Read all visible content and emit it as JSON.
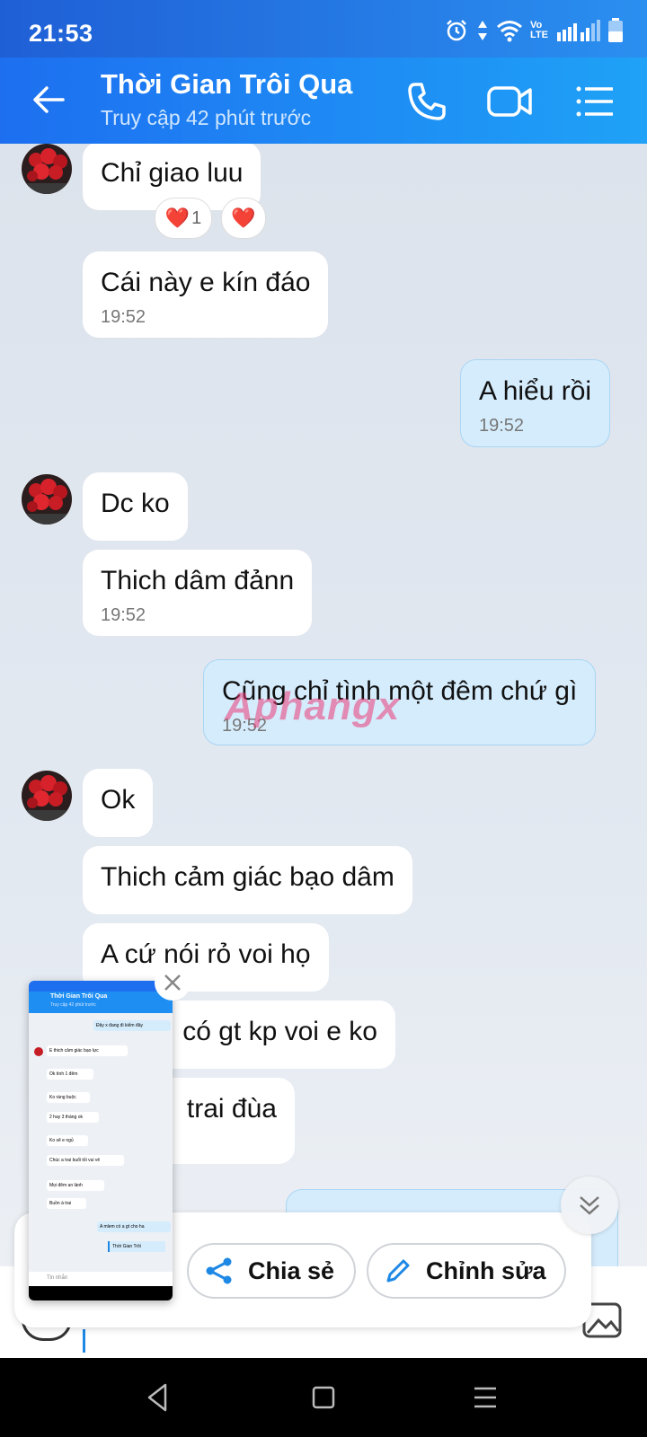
{
  "status_bar": {
    "time": "21:53",
    "network_label": "Vo LTE"
  },
  "header": {
    "title": "Thời Gian Trôi Qua",
    "subtitle": "Truy cập 42 phút trước"
  },
  "messages": [
    {
      "dir": "in",
      "text": "Chỉ giao luu",
      "time": "",
      "reactions": [
        {
          "emoji": "❤️",
          "count": "1"
        },
        {
          "emoji": "❤️",
          "count": ""
        }
      ]
    },
    {
      "dir": "in",
      "text": "Cái này e kín đáo",
      "time": "19:52"
    },
    {
      "dir": "out",
      "text": "A hiểu rồi",
      "time": "19:52"
    },
    {
      "dir": "in",
      "text": "Dc ko",
      "time": ""
    },
    {
      "dir": "in",
      "text": "Thich dâm đảnn",
      "time": "19:52"
    },
    {
      "dir": "out",
      "text": "Cũng chỉ tình một đêm chứ gì",
      "time": "19:52"
    },
    {
      "dir": "in",
      "text": "Ok",
      "time": ""
    },
    {
      "dir": "in",
      "text": "Thich cảm giác bạo dâm",
      "time": ""
    },
    {
      "dir": "in",
      "text": "A cứ nói rỏ voi họ",
      "time": ""
    },
    {
      "dir": "in",
      "text": "có gt kp voi e ko",
      "time": ""
    },
    {
      "dir": "in",
      "text": "trai đùa",
      "time": ""
    }
  ],
  "watermark": "Aphangx",
  "share_bar": {
    "share_label": "Chia sẻ",
    "edit_label": "Chỉnh sửa"
  },
  "screenshot_thumbnail": {
    "header_title": "Thời Gian Trôi Qua",
    "header_subtitle": "Truy cập 42 phút trước",
    "lines": [
      "Đây x đang đi kiếm đây",
      "E thich cảm giác bạo lực",
      "Ok tình 1 đêm",
      "Ko ràng buộc",
      "2 hay 3 tháng ok",
      "Ko sẽ e ngủ",
      "Chúc a trai buổi tối vui vẻ",
      "Mọi đêm an lành",
      "Buồn à trai",
      "A mlem có a gt cho ha",
      "Thời Gian Trôi"
    ],
    "input_placeholder": "Tin nhắn"
  },
  "colors": {
    "header_start": "#1d6ff0",
    "header_end": "#1fa2f7",
    "outgoing_bubble": "#d5ecfc",
    "accent": "#1e88e5"
  }
}
